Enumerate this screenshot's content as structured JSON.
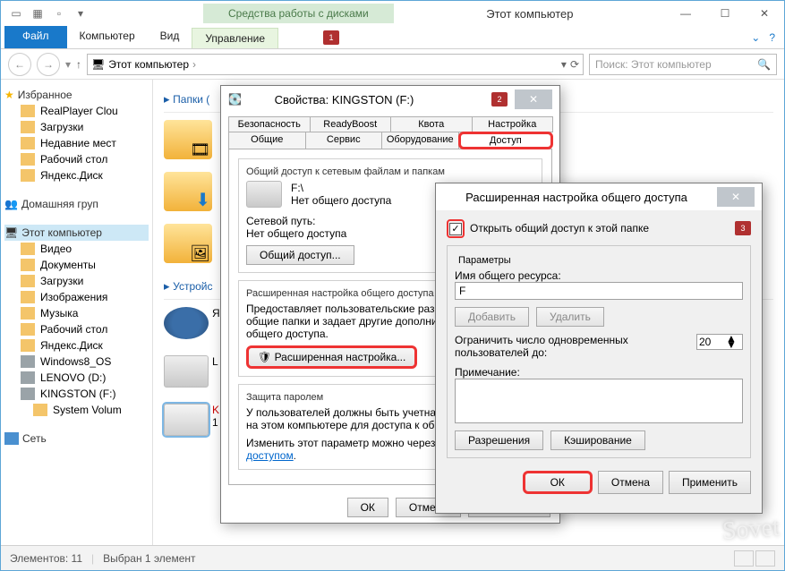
{
  "window": {
    "context_tab": "Средства работы с дисками",
    "title": "Этот компьютер",
    "tabs": {
      "file": "Файл",
      "computer": "Компьютер",
      "view": "Вид",
      "manage": "Управление"
    },
    "marker1": "1"
  },
  "addr": {
    "crumb": "Этот компьютер",
    "search_placeholder": "Поиск: Этот компьютер"
  },
  "nav": {
    "favorites": "Избранное",
    "fav_items": [
      "RealPlayer Clou",
      "Загрузки",
      "Недавние мест",
      "Рабочий стол",
      "Яндекс.Диск"
    ],
    "homegroup": "Домашняя груп",
    "thispc": "Этот компьютер",
    "pc_items": [
      "Видео",
      "Документы",
      "Загрузки",
      "Изображения",
      "Музыка",
      "Рабочий стол",
      "Яндекс.Диск",
      "Windows8_OS",
      "LENOVO (D:)",
      "KINGSTON (F:)",
      "System Volum"
    ],
    "network": "Сеть"
  },
  "content": {
    "folders_hdr": "Папки (",
    "devices_hdr": "Устройс",
    "ya": "Я",
    "l": "L",
    "k": "K",
    "one": "1"
  },
  "status": {
    "count": "Элементов: 11",
    "sel": "Выбран 1 элемент"
  },
  "props": {
    "title": "Свойства: KINGSTON (F:)",
    "marker": "2",
    "tabs_top": [
      "Безопасность",
      "ReadyBoost",
      "Квота",
      "Настройка"
    ],
    "tabs_bot": [
      "Общие",
      "Сервис",
      "Оборудование",
      "Доступ"
    ],
    "share_group": "Общий доступ к сетевым файлам и папкам",
    "path": "F:\\",
    "no_share": "Нет общего доступа",
    "netpath_lbl": "Сетевой путь:",
    "netpath_val": "Нет общего доступа",
    "share_btn": "Общий доступ...",
    "adv_hdr": "Расширенная настройка общего доступа",
    "adv_desc1": "Предоставляет пользовательские разр",
    "adv_desc2": "общие папки и задает другие дополните",
    "adv_desc3": "общего доступа.",
    "adv_btn": "Расширенная настройка...",
    "pwd_hdr": "Защита паролем",
    "pwd_desc1": "У пользователей должны быть учетная",
    "pwd_desc2": "на этом компьютере для доступа к общ",
    "pwd_link_pre": "Изменить этот параметр можно через ",
    "pwd_link": "сетями и общим доступом",
    "ok": "ОК",
    "cancel": "Отмена",
    "apply": "Применить"
  },
  "share": {
    "title": "Расширенная настройка общего доступа",
    "marker": "3",
    "chk_label": "Открыть общий доступ к этой папке",
    "params": "Параметры",
    "name_lbl": "Имя общего ресурса:",
    "name_val": "F",
    "add": "Добавить",
    "remove": "Удалить",
    "limit_lbl1": "Ограничить число одновременных",
    "limit_lbl2": "пользователей до:",
    "limit_val": "20",
    "note_lbl": "Примечание:",
    "perms": "Разрешения",
    "cache": "Кэширование",
    "ok": "ОК",
    "cancel": "Отмена",
    "apply": "Применить"
  },
  "watermark": "Sovet"
}
